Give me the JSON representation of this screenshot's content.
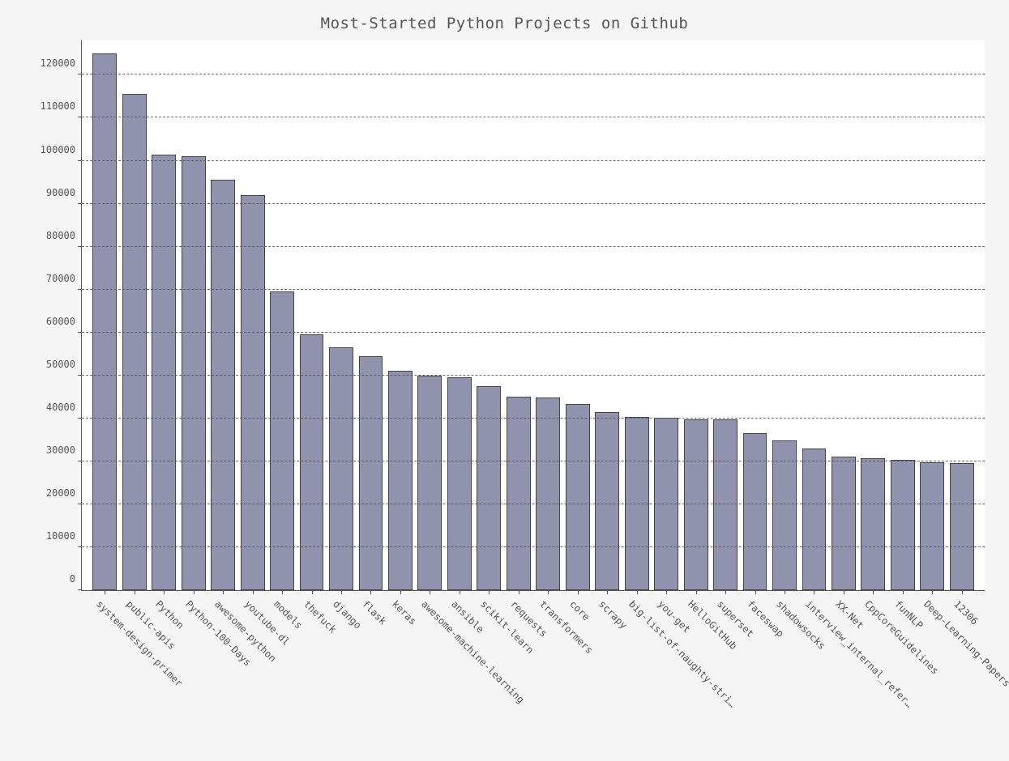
{
  "chart_data": {
    "type": "bar",
    "title": "Most-Started Python Projects on Github",
    "xlabel": "",
    "ylabel": "",
    "ylim": [
      0,
      128000
    ],
    "yticks": [
      0,
      10000,
      20000,
      30000,
      40000,
      50000,
      60000,
      70000,
      80000,
      90000,
      100000,
      110000,
      120000
    ],
    "categories": [
      "system-design-primer",
      "public-apis",
      "Python",
      "Python-100-Days",
      "awesome-python",
      "youtube-dl",
      "models",
      "thefuck",
      "django",
      "flask",
      "keras",
      "awesome-machine-learning",
      "ansible",
      "scikit-learn",
      "requests",
      "transformers",
      "core",
      "scrapy",
      "big-list-of-naughty-stri…",
      "you-get",
      "HelloGitHub",
      "superset",
      "faceswap",
      "shadowsocks",
      "interview_internal_refer…",
      "XX-Net",
      "CppCoreGuidelines",
      "funNLP",
      "Deep-Learning-Papers-Rea…",
      "12306"
    ],
    "values": [
      125000,
      115500,
      101500,
      101000,
      95500,
      92000,
      69500,
      59500,
      56500,
      54500,
      51000,
      50000,
      49500,
      47500,
      45000,
      44800,
      43300,
      41400,
      40300,
      40200,
      39800,
      39700,
      36500,
      34800,
      33000,
      31200,
      30800,
      30400,
      29800,
      29600
    ]
  }
}
